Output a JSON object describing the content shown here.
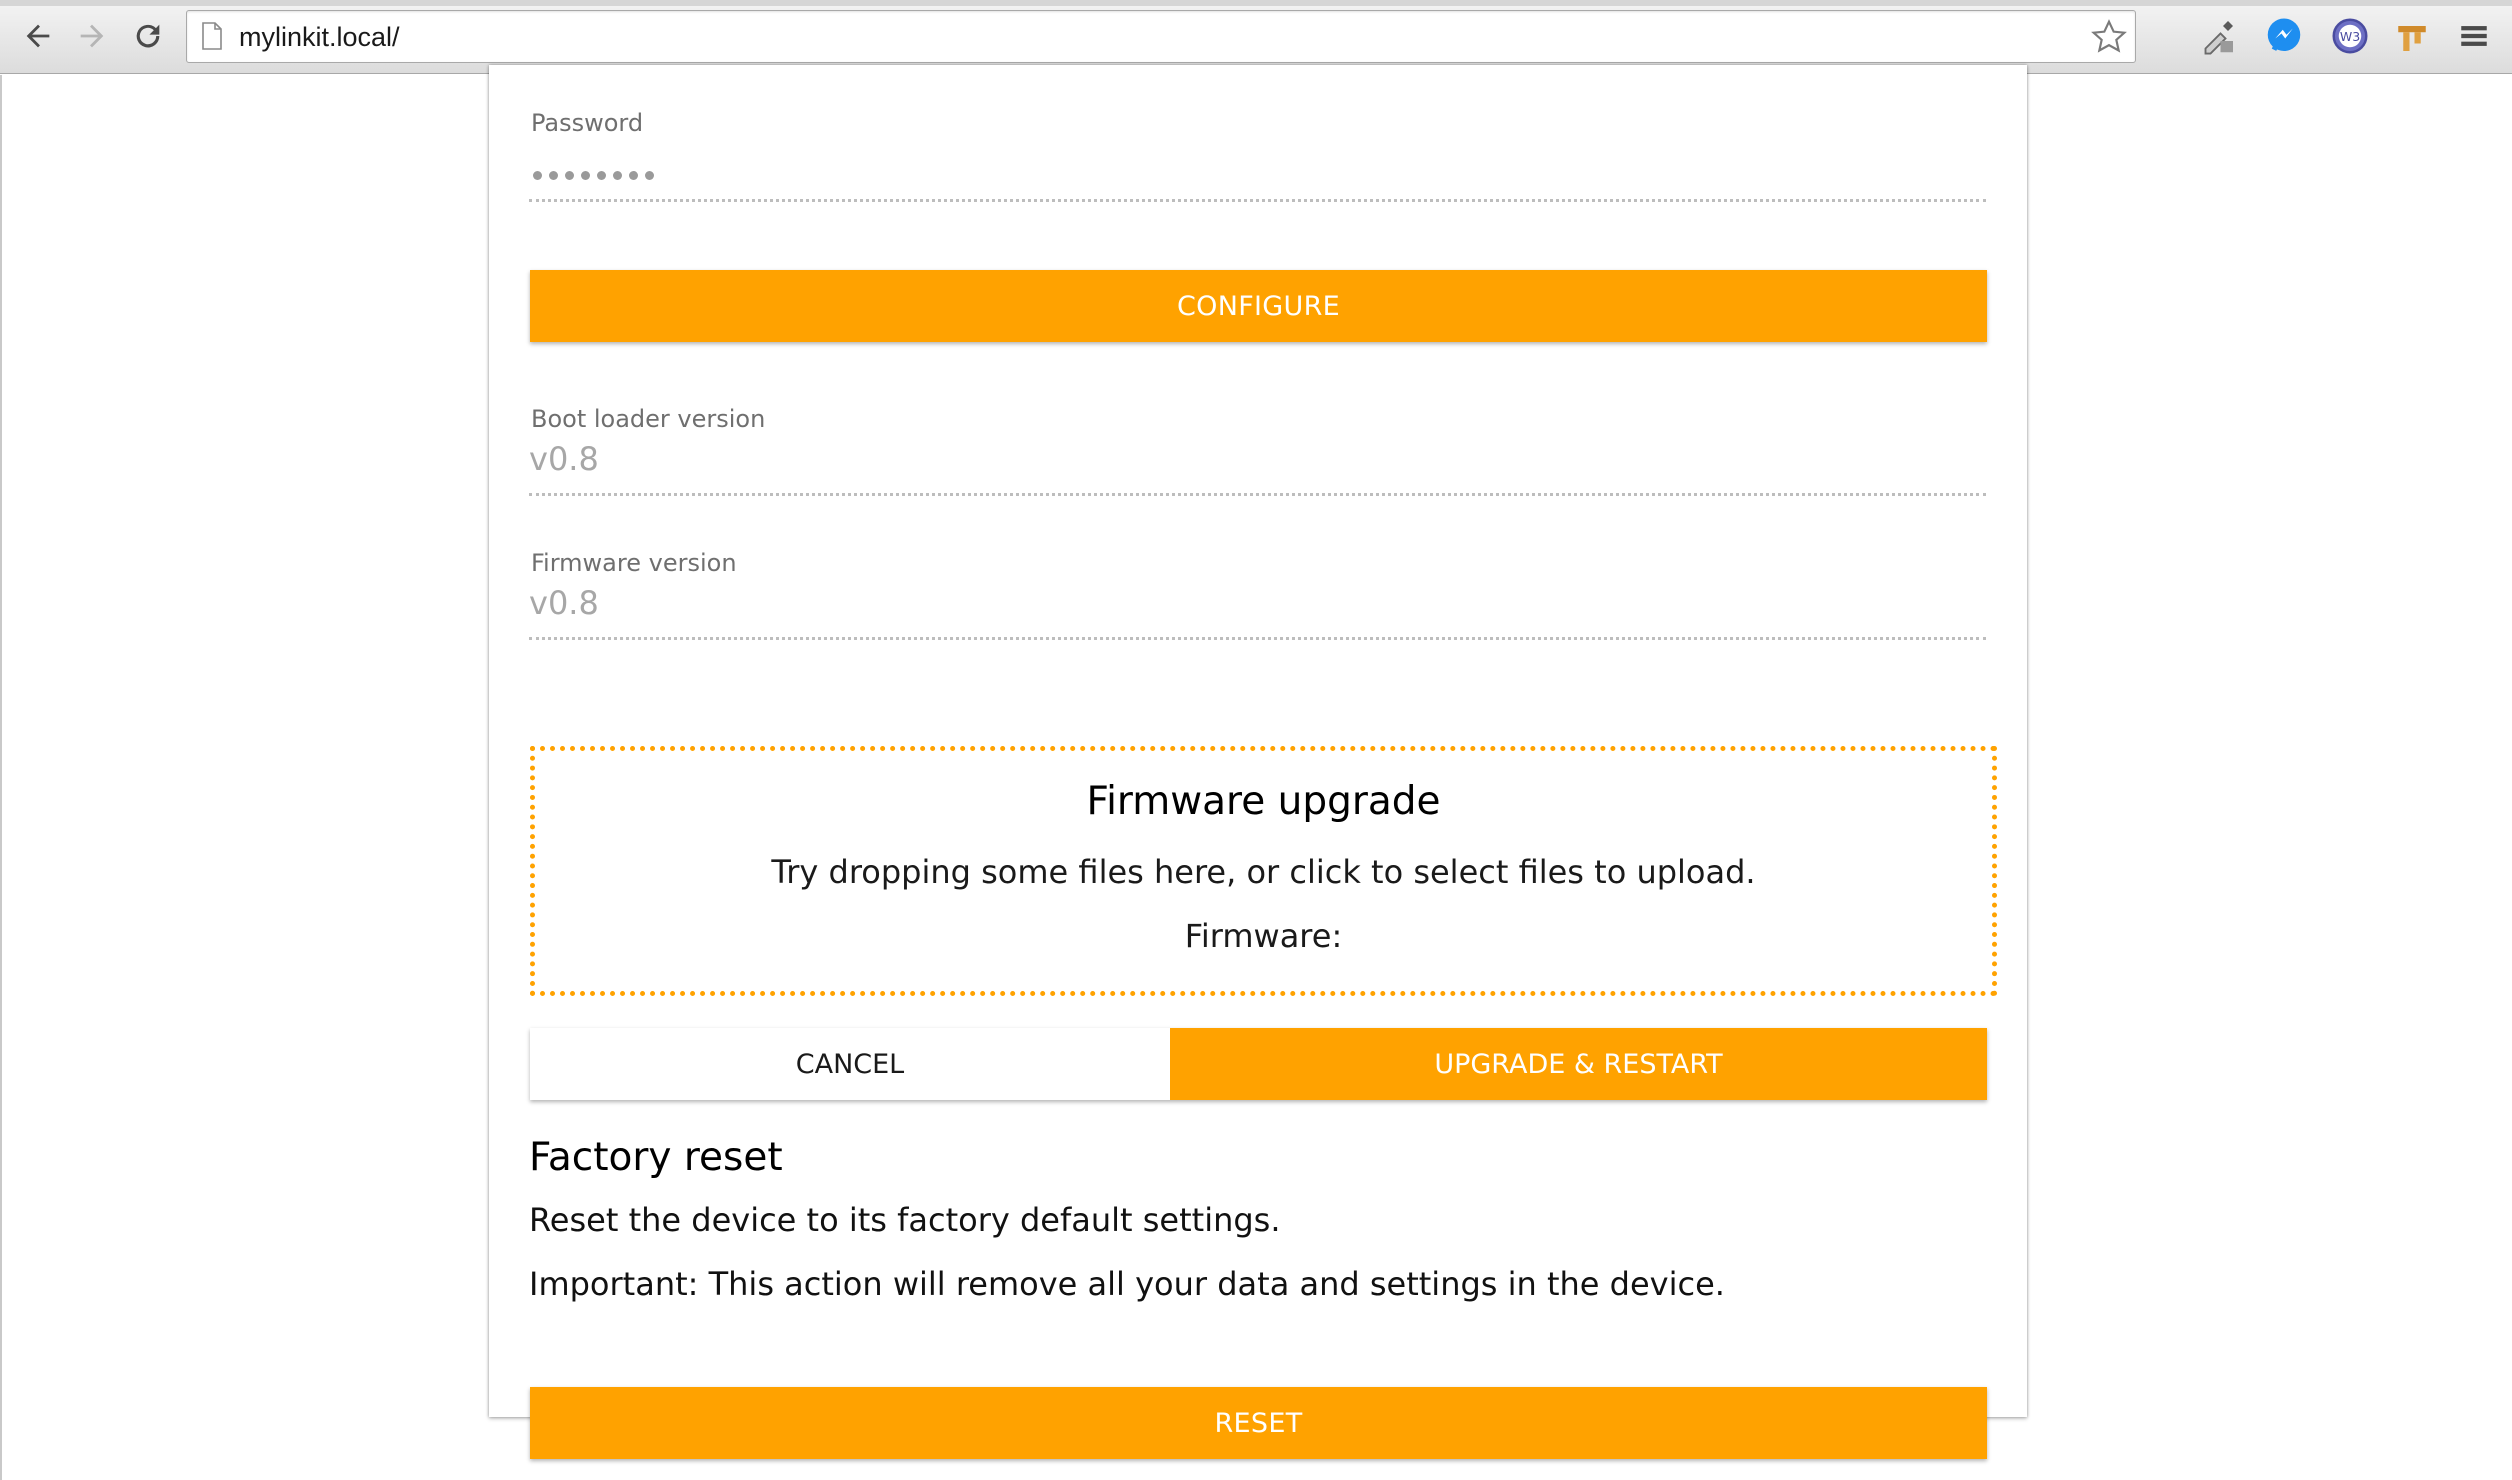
{
  "browser": {
    "url": "mylinkit.local/"
  },
  "password": {
    "label": "Password",
    "masked_length": 8
  },
  "configure_button": "CONFIGURE",
  "bootloader": {
    "label": "Boot loader version",
    "value": "v0.8"
  },
  "firmware": {
    "label": "Firmware version",
    "value": "v0.8"
  },
  "upgrade": {
    "title": "Firmware upgrade",
    "instructions": "Try dropping some files here, or click to select files to upload.",
    "firmware_label": "Firmware:",
    "cancel_label": "CANCEL",
    "upgrade_label": "UPGRADE & RESTART"
  },
  "factory_reset": {
    "title": "Factory reset",
    "description": "Reset the device to its factory default settings.",
    "warning": "Important: This action will remove all your data and settings in the device.",
    "reset_label": "RESET"
  },
  "colors": {
    "accent": "#ffa200",
    "label_gray": "#6f6f6f",
    "value_gray": "#a7a7a7"
  },
  "icons": [
    "back-icon",
    "forward-icon",
    "reload-icon",
    "page-icon",
    "star-icon",
    "eyedropper-icon",
    "messenger-icon",
    "w3-icon",
    "bookmarks-ext-icon",
    "menu-icon"
  ]
}
